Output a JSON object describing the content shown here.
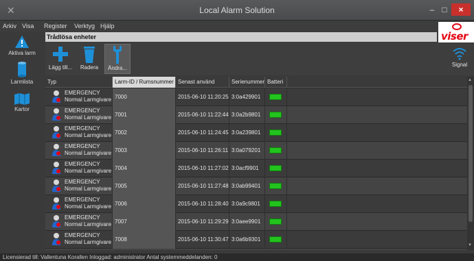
{
  "window": {
    "title": "Local Alarm Solution"
  },
  "menu": [
    "Arkiv",
    "Visa",
    "Register",
    "Verktyg",
    "Hjälp"
  ],
  "subheader": "Trådlösa enheter",
  "logo": "viser",
  "sidebar": [
    {
      "label": "Aktiva larm",
      "icon": "warning-icon"
    },
    {
      "label": "Larmlista",
      "icon": "cylinder-icon"
    },
    {
      "label": "Kartor",
      "icon": "map-icon"
    }
  ],
  "toolbar": {
    "add": "Lägg till...",
    "delete": "Radera",
    "edit": "Ändra...",
    "signal": "Signal"
  },
  "table": {
    "columns": [
      "Typ",
      "Larm-ID / Rumsnummer",
      "Senast använd",
      "Serienummer",
      "Batteri"
    ],
    "rows": [
      {
        "type_title": "EMERGENCY",
        "type_sub": "Normal Larmgivare",
        "id": "7000",
        "last_used": "2015-06-10 11:20:25",
        "serial": "3:0a429901",
        "battery": "ok"
      },
      {
        "type_title": "EMERGENCY",
        "type_sub": "Normal Larmgivare",
        "id": "7001",
        "last_used": "2015-06-10 11:22:44",
        "serial": "3:0a2b9801",
        "battery": "ok"
      },
      {
        "type_title": "EMERGENCY",
        "type_sub": "Normal Larmgivare",
        "id": "7002",
        "last_used": "2015-06-10 11:24:45",
        "serial": "3:0a239801",
        "battery": "ok"
      },
      {
        "type_title": "EMERGENCY",
        "type_sub": "Normal Larmgivare",
        "id": "7003",
        "last_used": "2015-06-10 11:26:11",
        "serial": "3:0a079201",
        "battery": "ok"
      },
      {
        "type_title": "EMERGENCY",
        "type_sub": "Normal Larmgivare",
        "id": "7004",
        "last_used": "2015-06-10 11:27:02",
        "serial": "3:0acf9901",
        "battery": "ok"
      },
      {
        "type_title": "EMERGENCY",
        "type_sub": "Normal Larmgivare",
        "id": "7005",
        "last_used": "2015-06-10 11:27:48",
        "serial": "3:0ab99401",
        "battery": "ok"
      },
      {
        "type_title": "EMERGENCY",
        "type_sub": "Normal Larmgivare",
        "id": "7006",
        "last_used": "2015-06-10 11:28:40",
        "serial": "3:0a9c9801",
        "battery": "ok"
      },
      {
        "type_title": "EMERGENCY",
        "type_sub": "Normal Larmgivare",
        "id": "7007",
        "last_used": "2015-06-10 11:29:29",
        "serial": "3:0aee9901",
        "battery": "ok"
      },
      {
        "type_title": "EMERGENCY",
        "type_sub": "Normal Larmgivare",
        "id": "7008",
        "last_used": "2015-06-10 11:30:47",
        "serial": "3:0a6b9301",
        "battery": "ok"
      }
    ]
  },
  "status": "Licensierad till: Vallentuna Korallen  Inloggad: administrator  Antal systemmeddelanden: 0",
  "colors": {
    "accent_blue": "#1e90d8",
    "battery_ok": "#22c41d",
    "brand_red": "#e30613"
  }
}
